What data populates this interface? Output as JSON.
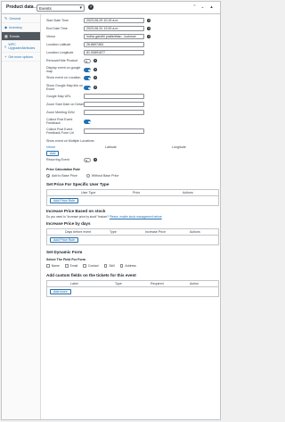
{
  "header": {
    "title": "Product data",
    "separator": "—",
    "product_type": "Events",
    "help": "?",
    "icons": [
      "chevron-up-icon",
      "chevron-down-icon",
      "caret-up-icon"
    ]
  },
  "sidebar": {
    "items": [
      {
        "label": "General",
        "icon": "wrench-icon",
        "active": false
      },
      {
        "label": "Inventory",
        "icon": "tag-icon",
        "active": false
      },
      {
        "label": "Events",
        "icon": "calendar-icon",
        "active": true
      },
      {
        "label": "WPC Upgrade/Attributes",
        "icon": "list-icon",
        "active": false
      },
      {
        "label": "Get more options",
        "icon": "plus-icon",
        "active": false
      }
    ]
  },
  "fields": {
    "start_date": {
      "label": "Start Date Time",
      "value": "2023-06-29 10:15 a.m."
    },
    "end_date": {
      "label": "End Date Time",
      "value": "2023-06-31 12:00 a.m."
    },
    "venue": {
      "label": "Venue",
      "value": "Indira gandhi pratishthan , lucknow"
    },
    "latitude": {
      "label": "Location Latitude",
      "value": "26.8697463"
    },
    "longitude": {
      "label": "Location Longitude",
      "value": "81.00891877"
    },
    "remove_product": {
      "label": "Remove/Hide Product",
      "value": "off"
    },
    "display_map": {
      "label": "Display event on google map",
      "value": "on"
    },
    "show_location": {
      "label": "Show event on Location",
      "value": "on"
    },
    "show_google_map": {
      "label": "Show Google Map link on Event",
      "value": "on"
    },
    "google_map_url": {
      "label": "Google Map URL",
      "value": ""
    },
    "zoom_level": {
      "label": "Zoom Start Date on Detail",
      "value": ""
    },
    "zoom_meeting": {
      "label": "Zoom Meeting ID/Id",
      "value": ""
    },
    "collect_feedback": {
      "label": "Collect Post Event Feedback",
      "value": "on"
    },
    "feedback_form_url": {
      "label": "Collect Post Event Feedback Form Url",
      "value": ""
    }
  },
  "multiple_locations": {
    "title": "Show event on Multiple Locations",
    "columns": [
      "Venue",
      "Latitude",
      "Longitude"
    ],
    "add_label": "Add"
  },
  "recurring": {
    "label": "Recurring Event",
    "value": "off"
  },
  "price_calc": {
    "title": "Price Calculation Rule",
    "options": [
      {
        "label": "Add to Base Price",
        "selected": true
      },
      {
        "label": "Without Base Price",
        "selected": false
      }
    ]
  },
  "user_price": {
    "title": "Set Price For Specific User Type",
    "columns": [
      "User Type",
      "Price",
      "Actions"
    ],
    "add_label": "Add Price Rule"
  },
  "stock_price": {
    "title": "Increase Price Based on stock",
    "note": "Do you need to \"Increase price by stock\" feature?",
    "link": "Please, enable stock management before"
  },
  "days_price": {
    "title": "Increase Price by days",
    "columns": [
      "Days before event",
      "Type",
      "Increase Price",
      "Actions"
    ],
    "add_label": "Add Price Rule"
  },
  "dynamic_form": {
    "title": "Set Dynamic Form",
    "subtitle": "Select The Field For Form",
    "fields": [
      "Name",
      "Email",
      "Contact",
      "Skill",
      "Address"
    ]
  },
  "custom_fields": {
    "title": "Add custom fields on the tickets for this event",
    "columns": [
      "Label",
      "Type",
      "Required",
      "Action"
    ],
    "add_label": "Add more"
  }
}
